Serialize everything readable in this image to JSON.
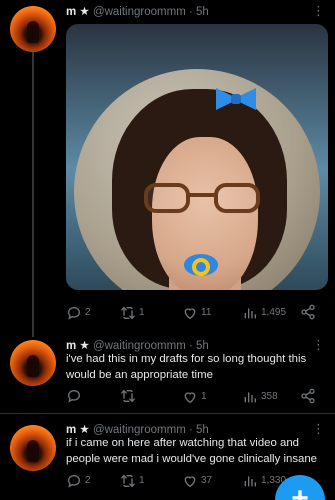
{
  "posts": [
    {
      "name": "m ★",
      "handle": "@waitingroommm",
      "dot": "·",
      "time": "5h",
      "text": "",
      "replies": "2",
      "reposts": "1",
      "likes": "11",
      "views": "1,495"
    },
    {
      "name": "m ★",
      "handle": "@waitingroommm",
      "dot": "·",
      "time": "5h",
      "text": "i've had this in my drafts for so long thought this would be an appropriate time",
      "replies": "",
      "reposts": "",
      "likes": "1",
      "views": "358"
    },
    {
      "name": "m ★",
      "handle": "@waitingroommm",
      "dot": "·",
      "time": "5h",
      "text": "if i came on here after watching that video and people were mad i would've gone clinically insane",
      "replies": "2",
      "reposts": "1",
      "likes": "37",
      "views": "1,330"
    }
  ],
  "more_glyph": "⋮",
  "fab_label": "+",
  "colors": {
    "background": "#000000",
    "muted": "#71767b",
    "text": "#e7e9ea",
    "accent": "#1d9bf0"
  },
  "icons": [
    "reply-icon",
    "repost-icon",
    "like-icon",
    "views-icon",
    "share-icon",
    "more-icon"
  ]
}
